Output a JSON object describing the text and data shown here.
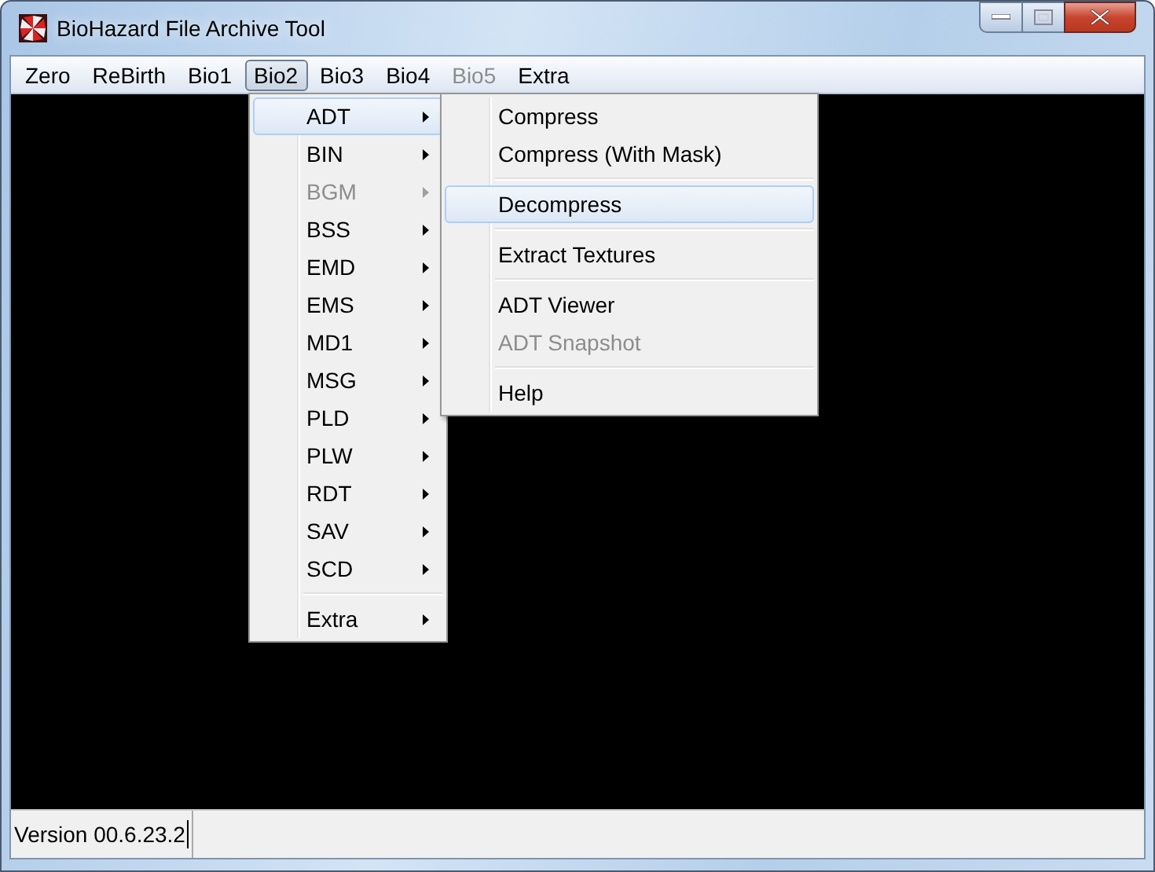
{
  "window": {
    "title": "BioHazard File Archive Tool"
  },
  "menu_bar": [
    {
      "label": "Zero",
      "selected": false,
      "disabled": false
    },
    {
      "label": "ReBirth",
      "selected": false,
      "disabled": false
    },
    {
      "label": "Bio1",
      "selected": false,
      "disabled": false
    },
    {
      "label": "Bio2",
      "selected": true,
      "disabled": false
    },
    {
      "label": "Bio3",
      "selected": false,
      "disabled": false
    },
    {
      "label": "Bio4",
      "selected": false,
      "disabled": false
    },
    {
      "label": "Bio5",
      "selected": false,
      "disabled": true
    },
    {
      "label": "Extra",
      "selected": false,
      "disabled": false
    }
  ],
  "menu": [
    {
      "kind": "submenu",
      "label": "ADT",
      "selected": true,
      "disabled": false
    },
    {
      "kind": "submenu",
      "label": "BIN",
      "selected": false,
      "disabled": false
    },
    {
      "kind": "submenu",
      "label": "BGM",
      "selected": false,
      "disabled": true
    },
    {
      "kind": "submenu",
      "label": "BSS",
      "selected": false,
      "disabled": false
    },
    {
      "kind": "submenu",
      "label": "EMD",
      "selected": false,
      "disabled": false
    },
    {
      "kind": "submenu",
      "label": "EMS",
      "selected": false,
      "disabled": false
    },
    {
      "kind": "submenu",
      "label": "MD1",
      "selected": false,
      "disabled": false
    },
    {
      "kind": "submenu",
      "label": "MSG",
      "selected": false,
      "disabled": false
    },
    {
      "kind": "submenu",
      "label": "PLD",
      "selected": false,
      "disabled": false
    },
    {
      "kind": "submenu",
      "label": "PLW",
      "selected": false,
      "disabled": false
    },
    {
      "kind": "submenu",
      "label": "RDT",
      "selected": false,
      "disabled": false
    },
    {
      "kind": "submenu",
      "label": "SAV",
      "selected": false,
      "disabled": false
    },
    {
      "kind": "submenu",
      "label": "SCD",
      "selected": false,
      "disabled": false
    },
    {
      "kind": "separator"
    },
    {
      "kind": "submenu",
      "label": "Extra",
      "selected": false,
      "disabled": false
    }
  ],
  "submenu": [
    {
      "kind": "item",
      "label": "Compress",
      "selected": false,
      "disabled": false
    },
    {
      "kind": "item",
      "label": "Compress (With Mask)",
      "selected": false,
      "disabled": false
    },
    {
      "kind": "separator"
    },
    {
      "kind": "item",
      "label": "Decompress",
      "selected": true,
      "disabled": false
    },
    {
      "kind": "separator"
    },
    {
      "kind": "item",
      "label": "Extract Textures",
      "selected": false,
      "disabled": false
    },
    {
      "kind": "separator"
    },
    {
      "kind": "item",
      "label": "ADT Viewer",
      "selected": false,
      "disabled": false
    },
    {
      "kind": "item",
      "label": "ADT Snapshot",
      "selected": false,
      "disabled": true
    },
    {
      "kind": "separator"
    },
    {
      "kind": "item",
      "label": "Help",
      "selected": false,
      "disabled": false
    }
  ],
  "status_bar": {
    "value": "Version 00.6.23.2"
  }
}
